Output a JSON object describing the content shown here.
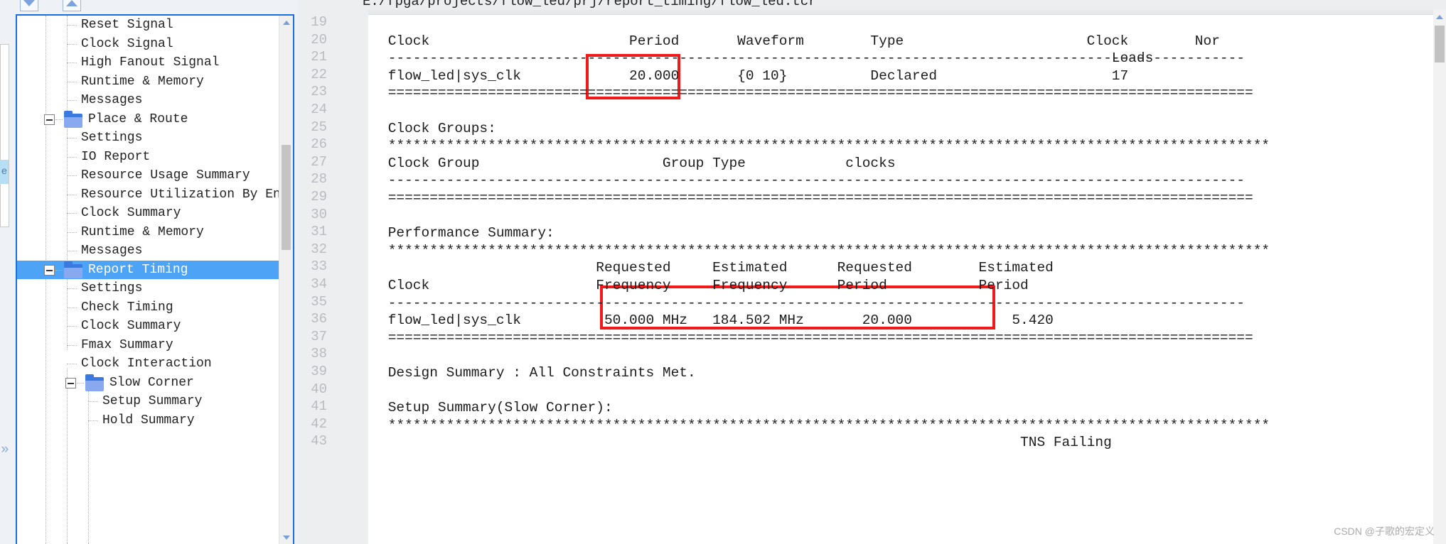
{
  "window": {
    "file_path": "E:/fpga/projects/flow_led/prj/report_timing/flow_led.tcr"
  },
  "toolbar": {
    "collapse_all_icon": "triangle-down-icon",
    "expand_all_icon": "triangle-up-icon"
  },
  "sidebar": {
    "panel_tab_label": "e",
    "expand_chevron": "»",
    "items": [
      {
        "label": "Reset Signal",
        "depth": 2,
        "type": "leaf",
        "selected": false
      },
      {
        "label": "Clock Signal",
        "depth": 2,
        "type": "leaf",
        "selected": false
      },
      {
        "label": "High Fanout Signal",
        "depth": 2,
        "type": "leaf",
        "selected": false
      },
      {
        "label": "Runtime & Memory",
        "depth": 2,
        "type": "leaf",
        "selected": false
      },
      {
        "label": "Messages",
        "depth": 2,
        "type": "last",
        "selected": false
      },
      {
        "label": "Place & Route",
        "depth": 1,
        "type": "folder",
        "selected": false
      },
      {
        "label": "Settings",
        "depth": 2,
        "type": "leaf",
        "selected": false
      },
      {
        "label": "IO Report",
        "depth": 2,
        "type": "leaf",
        "selected": false
      },
      {
        "label": "Resource Usage Summary",
        "depth": 2,
        "type": "leaf",
        "selected": false
      },
      {
        "label": "Resource Utilization By En…",
        "depth": 2,
        "type": "leaf",
        "selected": false
      },
      {
        "label": "Clock Summary",
        "depth": 2,
        "type": "leaf",
        "selected": false
      },
      {
        "label": "Runtime & Memory",
        "depth": 2,
        "type": "leaf",
        "selected": false
      },
      {
        "label": "Messages",
        "depth": 2,
        "type": "last",
        "selected": false
      },
      {
        "label": "Report Timing",
        "depth": 1,
        "type": "folder",
        "selected": true
      },
      {
        "label": "Settings",
        "depth": 2,
        "type": "leaf",
        "selected": false
      },
      {
        "label": "Check Timing",
        "depth": 2,
        "type": "leaf",
        "selected": false
      },
      {
        "label": "Clock Summary",
        "depth": 2,
        "type": "leaf",
        "selected": false
      },
      {
        "label": "Fmax Summary",
        "depth": 2,
        "type": "leaf",
        "selected": false
      },
      {
        "label": "Clock Interaction",
        "depth": 2,
        "type": "leaf",
        "selected": false
      },
      {
        "label": "Slow Corner",
        "depth": 2,
        "type": "folder",
        "selected": false
      },
      {
        "label": "Setup Summary",
        "depth": 3,
        "type": "leaf",
        "selected": false
      },
      {
        "label": "Hold Summary",
        "depth": 3,
        "type": "leaf",
        "selected": false
      }
    ]
  },
  "editor": {
    "line_numbers": [
      19,
      20,
      21,
      22,
      23,
      24,
      25,
      26,
      27,
      28,
      29,
      30,
      31,
      32,
      33,
      34,
      35,
      36,
      37,
      38,
      39,
      40,
      41,
      42,
      43
    ],
    "lines": [
      "",
      " Clock                        Period       Waveform        Type                      Clock        Nor",
      " -------------------------------------------------------------------------------------------------------",
      " flow_led|sys_clk             20.000       {0 10}          Declared                     17",
      " ========================================================================================================",
      "",
      " Clock Groups:",
      " **********************************************************************************************************",
      " Clock Group                      Group Type            clocks",
      " -------------------------------------------------------------------------------------------------------",
      " ========================================================================================================",
      "",
      " Performance Summary:",
      " **********************************************************************************************************",
      "                          Requested     Estimated      Requested        Estimated",
      " Clock                    Frequency     Frequency      Period           Period",
      " -------------------------------------------------------------------------------------------------------",
      " flow_led|sys_clk          50.000 MHz   184.502 MHz       20.000            5.420",
      " ========================================================================================================",
      "",
      " Design Summary : All Constraints Met.",
      "",
      " Setup Summary(Slow Corner):",
      " **********************************************************************************************************",
      "                                                                             TNS Failing"
    ],
    "header_labels_row1": [
      "Clock",
      "Period",
      "Waveform",
      "Type",
      "Clock",
      "Nor"
    ],
    "header_labels_row2": [
      "Loads"
    ],
    "annotations": {
      "period_highlight_value": "20.000",
      "performance_highlight_values": [
        "50.000 MHz",
        "184.502 MHz",
        "20.000"
      ],
      "highlight_color": "#ef1b1b"
    }
  },
  "report": {
    "clock_table": {
      "columns": [
        "Clock",
        "Period",
        "Waveform",
        "Type",
        "Clock Loads",
        "Nor"
      ],
      "rows": [
        {
          "clock": "flow_led|sys_clk",
          "period": "20.000",
          "waveform": "{0 10}",
          "type": "Declared",
          "clock_loads": "17"
        }
      ]
    },
    "clock_groups": {
      "heading": "Clock Groups:",
      "columns": [
        "Clock Group",
        "Group Type",
        "clocks"
      ],
      "rows": []
    },
    "performance_summary": {
      "heading": "Performance Summary:",
      "columns": [
        "Clock",
        "Requested Frequency",
        "Estimated Frequency",
        "Requested Period",
        "Estimated Period"
      ],
      "rows": [
        {
          "clock": "flow_led|sys_clk",
          "requested_frequency": "50.000 MHz",
          "estimated_frequency": "184.502 MHz",
          "requested_period": "20.000",
          "estimated_period": "5.420"
        }
      ]
    },
    "design_summary": "Design Summary : All Constraints Met.",
    "setup_summary_heading": "Setup Summary(Slow Corner):",
    "tns_failing_label": "TNS Failing"
  },
  "watermark": {
    "line1": "CSDN @子歌的宏定义"
  }
}
